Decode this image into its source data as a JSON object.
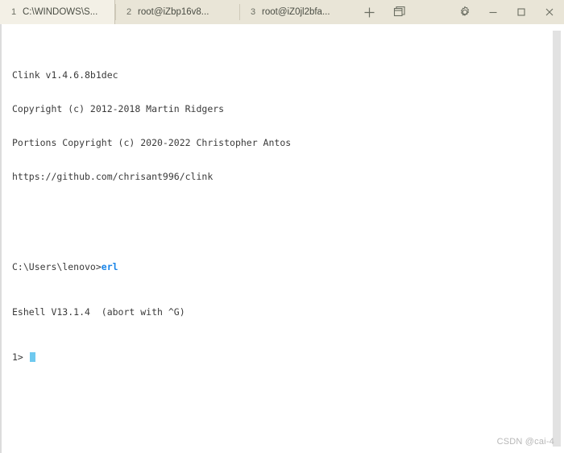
{
  "window": {
    "title": "Windows Terminal",
    "titlebar_color": "#e9e5d7",
    "content_color": "#ffffff"
  },
  "tabs": [
    {
      "number": "1",
      "label": "C:\\WINDOWS\\S...",
      "active": true
    },
    {
      "number": "2",
      "label": "root@iZbp16v8...",
      "active": false
    },
    {
      "number": "3",
      "label": "root@iZ0jl2bfa...",
      "active": false
    }
  ],
  "titlebar_buttons": {
    "new_tab": "+",
    "new_tab_name": "plus-icon",
    "dropdown": "panes-icon",
    "settings": "gear-icon",
    "minimize": "minimize-icon",
    "maximize": "maximize-icon",
    "close": "close-icon"
  },
  "terminal": {
    "accent_color": "#1884e8",
    "cursor_color": "#6fc9ef",
    "text_color": "#3a3a3a",
    "lines": [
      {
        "text": "Clink v1.4.6.8b1dec"
      },
      {
        "text": "Copyright (c) 2012-2018 Martin Ridgers"
      },
      {
        "text": "Portions Copyright (c) 2020-2022 Christopher Antos"
      },
      {
        "text": "https://github.com/chrisant996/clink"
      },
      {
        "text": ""
      },
      {
        "prompt": "C:\\Users\\lenovo>",
        "command": "erl"
      },
      {
        "text": "Eshell V13.1.4  (abort with ^G)"
      },
      {
        "prompt_short": "1> ",
        "cursor": true
      }
    ]
  },
  "watermark": {
    "text": "CSDN @cai-4"
  }
}
